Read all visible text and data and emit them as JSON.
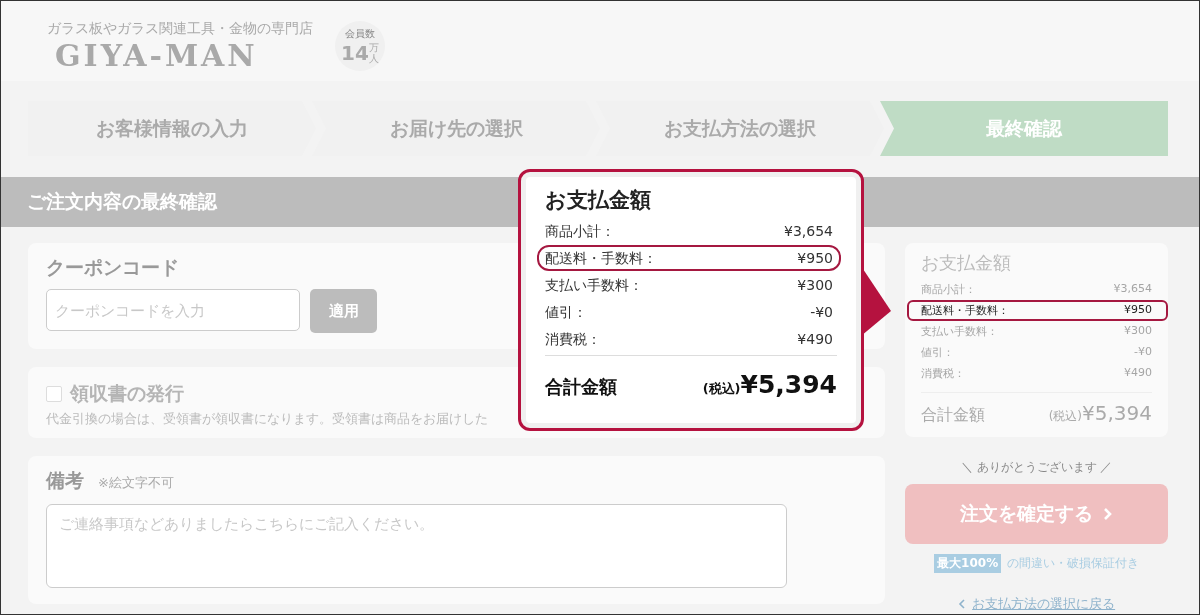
{
  "header": {
    "tagline": "ガラス板やガラス関連工具・金物の専門店",
    "logo": "GIYA-MAN",
    "members": {
      "label": "会員数",
      "count": "14",
      "unit": "万人"
    }
  },
  "steps": [
    {
      "label": "お客様情報の入力",
      "selected": false
    },
    {
      "label": "お届け先の選択",
      "selected": false
    },
    {
      "label": "お支払方法の選択",
      "selected": false
    },
    {
      "label": "最終確認",
      "selected": true
    }
  ],
  "section_title": "ご注文内容の最終確認",
  "coupon": {
    "title": "クーポンコード",
    "placeholder": "クーポンコードを入力",
    "button": "適用"
  },
  "receipt": {
    "label": "領収書の発行",
    "checked": false,
    "note": "代金引換の場合は、受領書が領収書になります。受領書は商品をお届けした"
  },
  "remarks": {
    "title": "備考",
    "note": "※絵文字不可",
    "placeholder": "ご連絡事項などありましたらこちらにご記入ください。"
  },
  "summary": {
    "title": "お支払金額",
    "rows": [
      {
        "label": "商品小計：",
        "value": "¥3,654",
        "highlighted": false
      },
      {
        "label": "配送料・手数料：",
        "value": "¥950",
        "highlighted": true
      },
      {
        "label": "支払い手数料：",
        "value": "¥300",
        "highlighted": false
      },
      {
        "label": "値引：",
        "value": "-¥0",
        "highlighted": false
      },
      {
        "label": "消費税：",
        "value": "¥490",
        "highlighted": false
      }
    ],
    "total_label": "合計金額",
    "tax_note": "(税込)",
    "total": "¥5,394"
  },
  "thanks": "＼ ありがとうございます ／",
  "confirm_button": "注文を確定する",
  "guarantee": {
    "badge": "最大100%",
    "text": "の間違い・破損保証付き"
  },
  "back_link": "お支払方法の選択に戻る",
  "callout": {
    "title": "お支払金額",
    "rows": [
      {
        "label": "商品小計：",
        "value": "¥3,654",
        "highlighted": false
      },
      {
        "label": "配送料・手数料：",
        "value": "¥950",
        "highlighted": true
      },
      {
        "label": "支払い手数料：",
        "value": "¥300",
        "highlighted": false
      },
      {
        "label": "値引：",
        "value": "-¥0",
        "highlighted": false
      },
      {
        "label": "消費税：",
        "value": "¥490",
        "highlighted": false
      }
    ],
    "total_label": "合計金額",
    "tax_note": "(税込)",
    "total": "¥5,394"
  }
}
